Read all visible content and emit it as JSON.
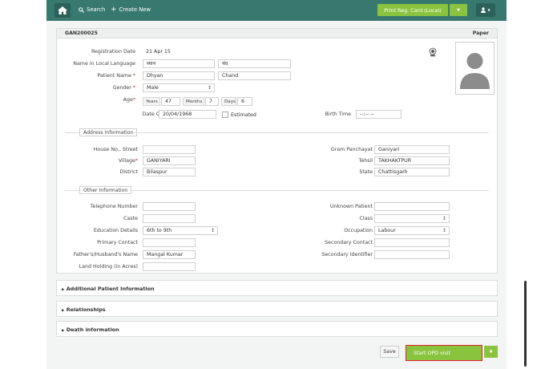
{
  "topbar": {
    "search_label": "Search",
    "create_label": "Create New",
    "print_label": "Print Reg. Card (Local)"
  },
  "card": {
    "patient_id": "GAN200025",
    "paper_label": "Paper"
  },
  "form": {
    "registration_date_label": "Registration Date",
    "registration_date_value": "21 Apr 15",
    "local_name_label": "Name in Local Language",
    "local_first": "ध्यान",
    "local_last": "चंद",
    "patient_name_label": "Patient Name",
    "first_name": "Dhyan",
    "last_name": "Chand",
    "gender_label": "Gender",
    "gender_value": "Male",
    "age_label": "Age",
    "years_label": "Years",
    "years_value": "47",
    "months_label": "Months",
    "months_value": "7",
    "days_label": "Days",
    "days_value": "6",
    "dob_label": "Date Of Birth",
    "dob_value": "20/04/1968",
    "estimated_label": "Estimated",
    "birth_time_label": "Birth Time",
    "birth_time_value": "--:-- --"
  },
  "address": {
    "section_label": "Address Information",
    "house_label": "House No., Street",
    "house_value": "",
    "village_label": "Village",
    "village_value": "GANIYARI",
    "district_label": "District",
    "district_value": "Bilaspur",
    "gram_label": "Gram Panchayat",
    "gram_value": "Ganiyari",
    "tehsil_label": "Tehsil",
    "tehsil_value": "TAKHAKTPUR",
    "state_label": "State",
    "state_value": "Chattisgarh"
  },
  "other": {
    "section_label": "Other Information",
    "telephone_label": "Telephone Number",
    "telephone_value": "",
    "caste_label": "Caste",
    "caste_value": "",
    "education_label": "Education Details",
    "education_value": "6th to 9th",
    "primary_contact_label": "Primary Contact",
    "primary_contact_value": "",
    "father_label": "Father's/Husband's Name",
    "father_value": "Mangal Kumar",
    "land_label": "Land Holding (in Acres)",
    "land_value": "",
    "unknown_label": "Unknown Patient",
    "class_label": "Class",
    "class_value": "",
    "occupation_label": "Occupation",
    "occupation_value": "Labour",
    "secondary_contact_label": "Secondary Contact",
    "secondary_contact_value": "",
    "secondary_identifier_label": "Secondary Identifier",
    "secondary_identifier_value": ""
  },
  "accordions": {
    "additional": "Additional Patient Information",
    "relationships": "Relationships",
    "death": "Death information"
  },
  "actions": {
    "save": "Save",
    "start_opd": "Start OPD visit"
  }
}
